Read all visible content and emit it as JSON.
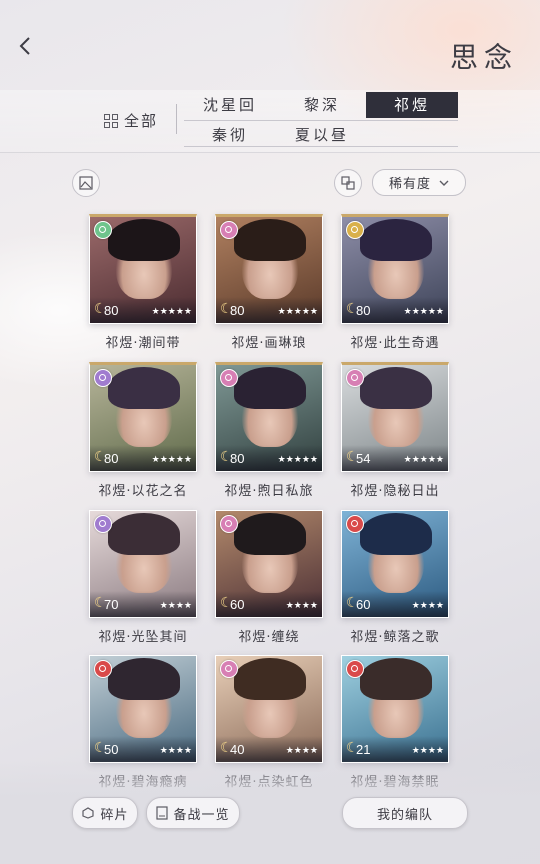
{
  "header": {
    "title": "思念",
    "back_icon": "chevron-left-icon"
  },
  "filters": {
    "all_label": "全部",
    "tabs": [
      {
        "label": "沈星回",
        "active": false
      },
      {
        "label": "黎深",
        "active": false
      },
      {
        "label": "祁煜",
        "active": true
      },
      {
        "label": "秦彻",
        "active": false
      },
      {
        "label": "夏以昼",
        "active": false
      }
    ]
  },
  "toolbar": {
    "sort_label": "稀有度",
    "left_icon": "gallery-icon",
    "right_icon": "layout-icon"
  },
  "cards": [
    {
      "name": "祁煜·潮间带",
      "level": "80",
      "stars": "★★★★★",
      "badge_color": "#6ec48c",
      "bg1": "#4a2b30",
      "bg2": "#9b6a6a",
      "hair": "#1c1518"
    },
    {
      "name": "祁煜·画琳琅",
      "level": "80",
      "stars": "★★★★★",
      "badge_color": "#d77fb4",
      "bg1": "#5a3a2a",
      "bg2": "#b08060",
      "hair": "#2a1d18"
    },
    {
      "name": "祁煜·此生奇遇",
      "level": "80",
      "stars": "★★★★★",
      "badge_color": "#d9b04a",
      "bg1": "#3d4358",
      "bg2": "#8e8ea8",
      "hair": "#2b2440"
    },
    {
      "name": "祁煜·以花之名",
      "level": "80",
      "stars": "★★★★★",
      "badge_color": "#a07ccf",
      "bg1": "#5f6a4a",
      "bg2": "#b7b59a",
      "hair": "#3a2f44"
    },
    {
      "name": "祁煜·煦日私旅",
      "level": "80",
      "stars": "★★★★★",
      "badge_color": "#d77fb4",
      "bg1": "#31403f",
      "bg2": "#7f9895",
      "hair": "#2a2233"
    },
    {
      "name": "祁煜·隐秘日出",
      "level": "54",
      "stars": "★★★★★",
      "badge_color": "#d77fb4",
      "bg1": "#7d8588",
      "bg2": "#d9dcde",
      "hair": "#3a3044"
    },
    {
      "name": "祁煜·光坠其间",
      "level": "70",
      "stars": "★★★★",
      "badge_color": "#a07ccf",
      "bg1": "#8a7a80",
      "bg2": "#e6dada",
      "hair": "#3b2d36"
    },
    {
      "name": "祁煜·缠绕",
      "level": "60",
      "stars": "★★★★",
      "badge_color": "#d77fb4",
      "bg1": "#4b2f35",
      "bg2": "#b38a6c",
      "hair": "#1f1a1c"
    },
    {
      "name": "祁煜·鲸落之歌",
      "level": "60",
      "stars": "★★★★",
      "badge_color": "#d94a4a",
      "bg1": "#2c5a80",
      "bg2": "#7fb3d6",
      "hair": "#1d2c4a"
    },
    {
      "name": "祁煜·碧海瘾病",
      "level": "50",
      "stars": "★★★★",
      "badge_color": "#d94a4a",
      "bg1": "#4a6a80",
      "bg2": "#c2cfd6",
      "hair": "#2f2630"
    },
    {
      "name": "祁煜·点染虹色",
      "level": "40",
      "stars": "★★★★",
      "badge_color": "#d77fb4",
      "bg1": "#8a6a58",
      "bg2": "#e8cfb8",
      "hair": "#3f2c22"
    },
    {
      "name": "祁煜·碧海禁眠",
      "level": "21",
      "stars": "★★★★",
      "badge_color": "#d94a4a",
      "bg1": "#3a7090",
      "bg2": "#9fd0e0",
      "hair": "#3a2c2a"
    }
  ],
  "bottom": {
    "fragments_label": "碎片",
    "backup_label": "备战一览",
    "team_label": "我的编队"
  }
}
